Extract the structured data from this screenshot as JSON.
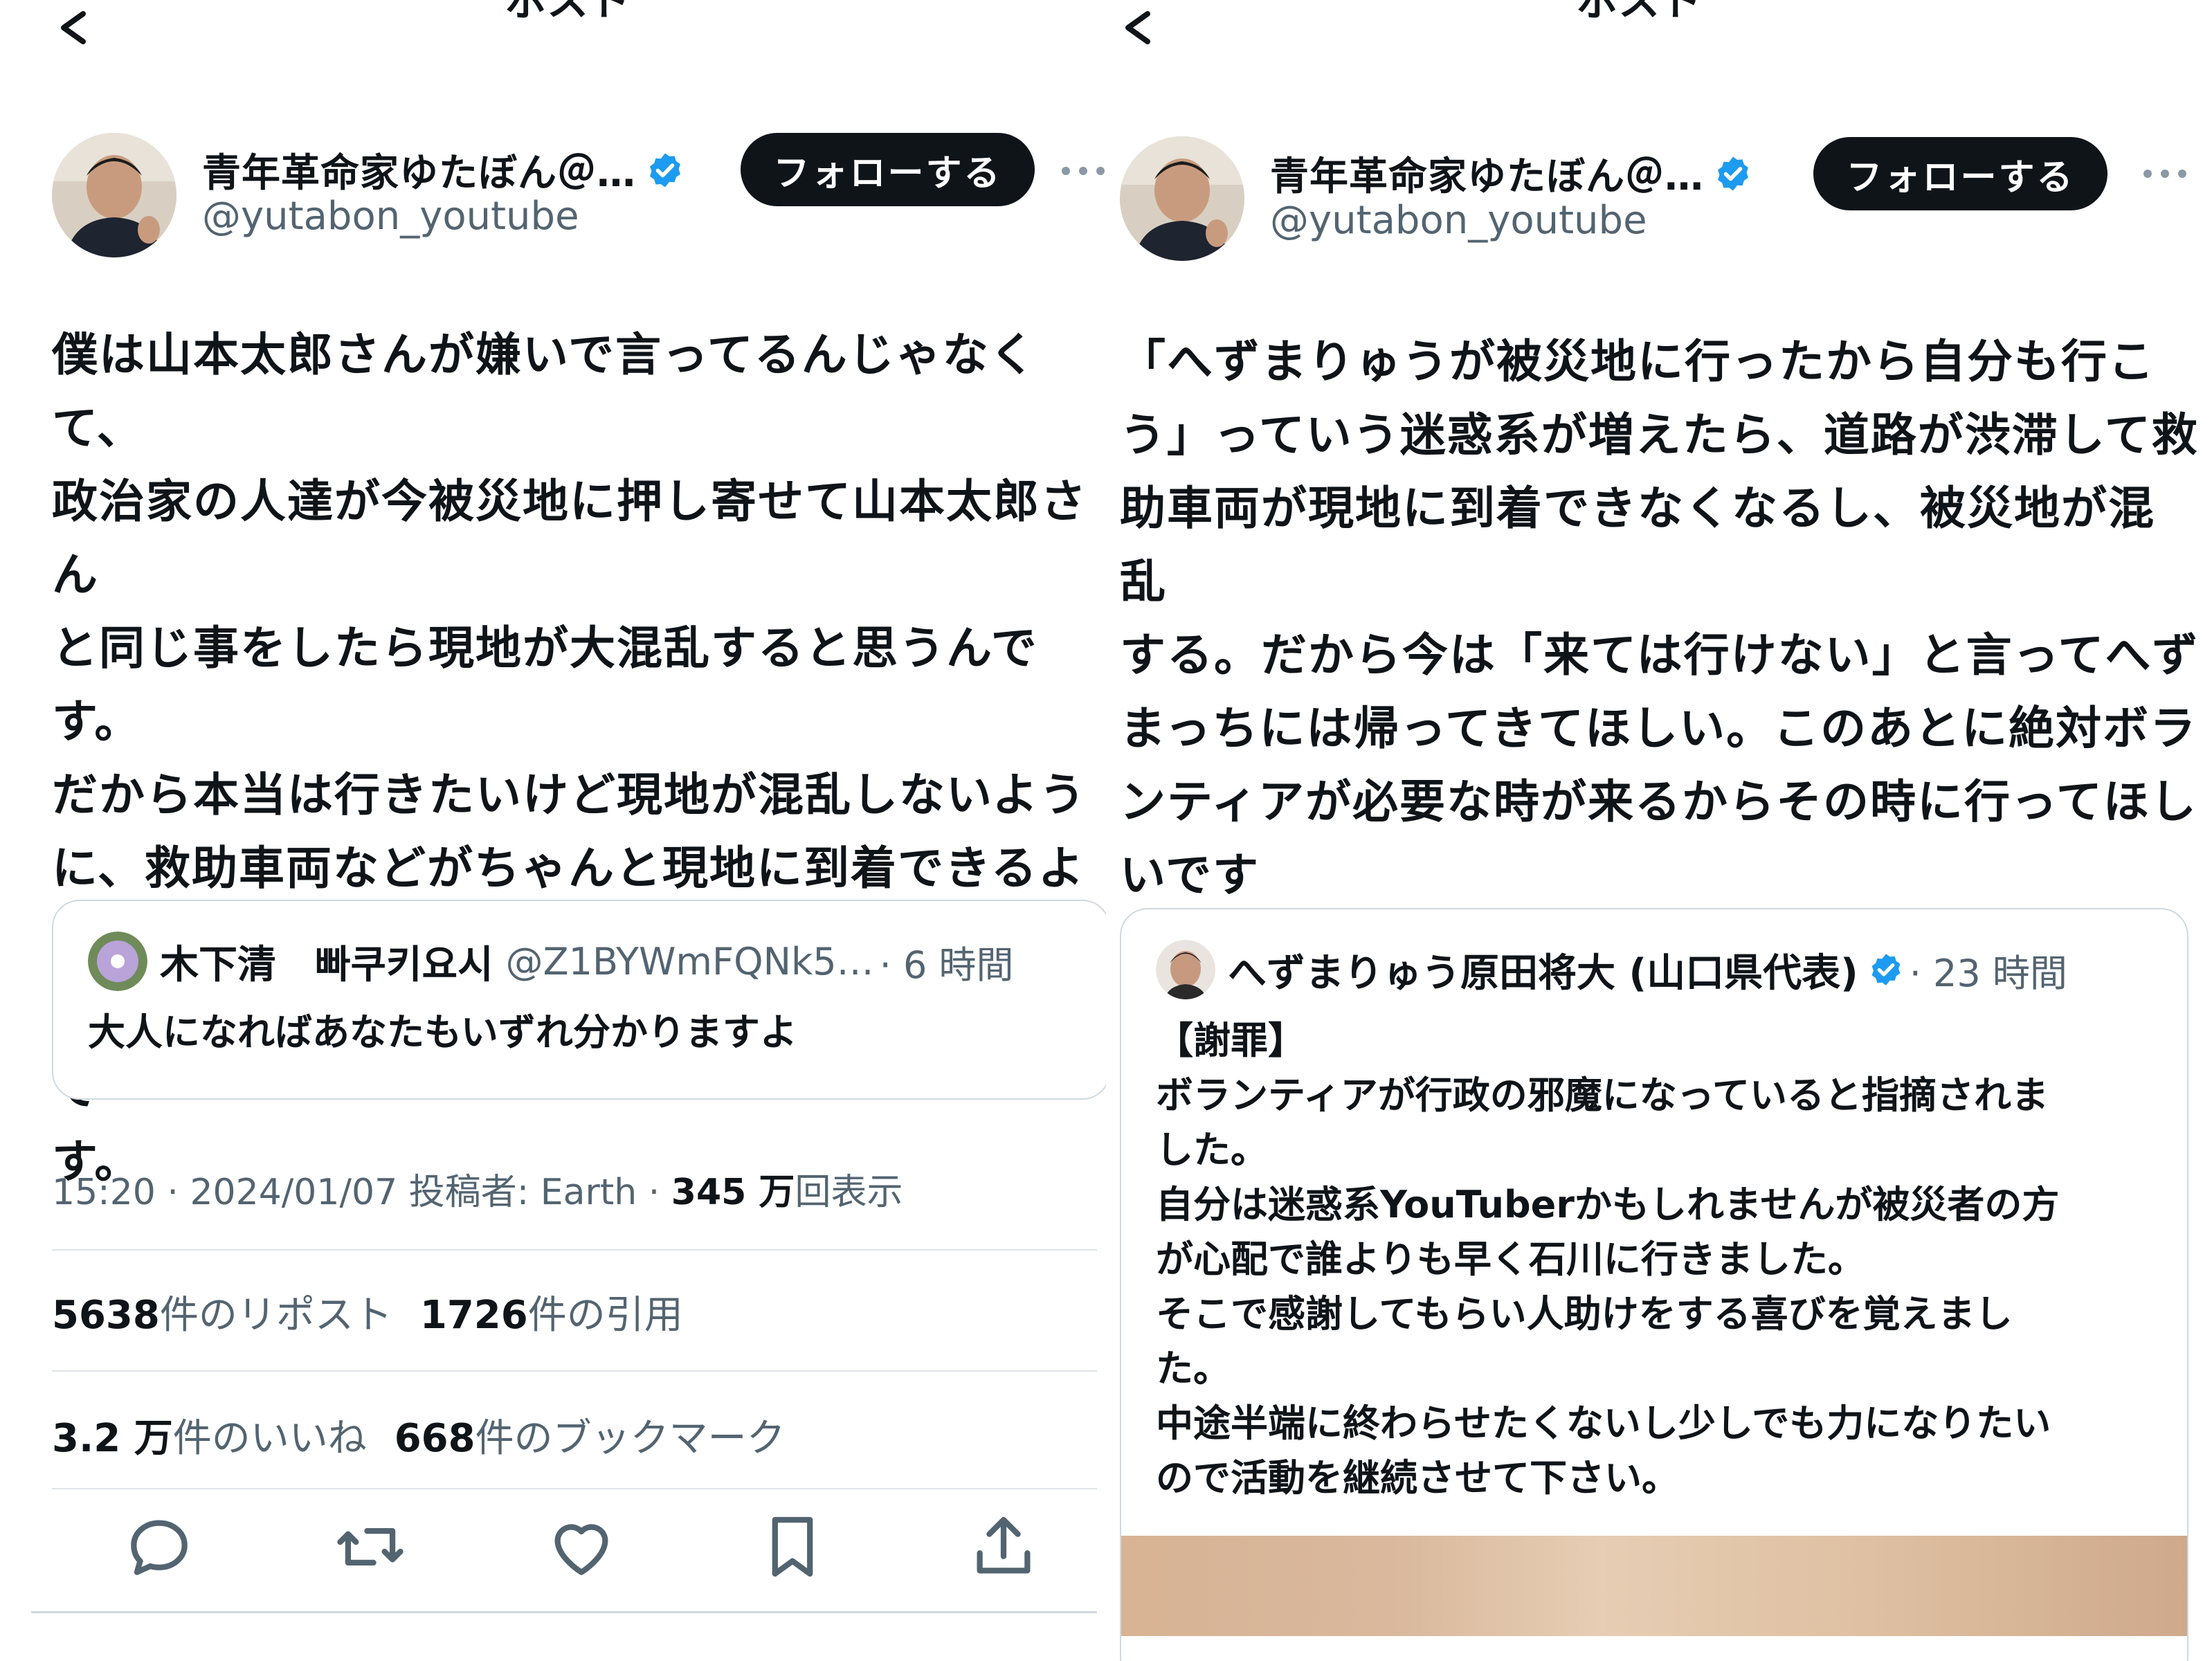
{
  "left": {
    "nav_title": "ポスト",
    "author": {
      "name": "青年革命家ゆたぼん＠…",
      "handle": "@yutabon_youtube"
    },
    "follow_label": "フォローする",
    "body": "僕は山本太郎さんが嫌いで言ってるんじゃなくて、\n政治家の人達が今被災地に押し寄せて山本太郎さん\nと同じ事をしたら現地が大混乱すると思うんです。\nだから本当は行きたいけど現地が混乱しないよう\nに、救助車両などがちゃんと現地に到着できるよう\nに、我慢している政治家さんもいると僕は思うんで\nす。",
    "quote": {
      "name": "木下清　빠쿠키요시",
      "handle": "@Z1BYWmFQNk5…",
      "time": "· 6 時間",
      "text": "大人になればあなたもいずれ分かりますよ"
    },
    "meta": {
      "time_date": "15:20 · 2024/01/07",
      "posted_by": "投稿者: Earth",
      "dot": "·",
      "views_num": "345 万",
      "views_label": "回表示"
    },
    "stats": [
      [
        {
          "num": "5638",
          "label": "件のリポスト"
        },
        {
          "num": "1726",
          "label": "件の引用"
        }
      ],
      [
        {
          "num": "3.2 万",
          "label": "件のいいね"
        },
        {
          "num": "668",
          "label": "件のブックマーク"
        }
      ]
    ],
    "actions": [
      "reply-icon",
      "repost-icon",
      "like-icon",
      "bookmark-icon",
      "share-icon"
    ]
  },
  "right": {
    "nav_title": "ポスト",
    "author": {
      "name": "青年革命家ゆたぼん＠…",
      "handle": "@yutabon_youtube"
    },
    "follow_label": "フォローする",
    "body": "「へずまりゅうが被災地に行ったから自分も行こ\nう」っていう迷惑系が増えたら、道路が渋滞して救\n助車両が現地に到着できなくなるし、被災地が混乱\nする。だから今は「来ては行けない」と言ってへず\nまっちには帰ってきてほしい。このあとに絶対ボラ\nンティアが必要な時が来るからその時に行ってほし\nいです",
    "quote": {
      "name": "へずまりゅう原田将大 (山口県代表)",
      "time": "· 23 時間",
      "text": "【謝罪】\nボランティアが行政の邪魔になっていると指摘されま\nした。\n自分は迷惑系YouTuberかもしれませんが被災者の方\nが心配で誰よりも早く石川に行きました。\nそこで感謝してもらい人助けをする喜びを覚えまし\nた。\n中途半端に終わらせたくないし少しでも力になりたい\nので活動を継続させて下さい。"
    }
  },
  "colors": {
    "verified": "#1d9bf0",
    "follow_bg": "#0f1419",
    "muted": "#536471",
    "border": "#cfd9de"
  }
}
